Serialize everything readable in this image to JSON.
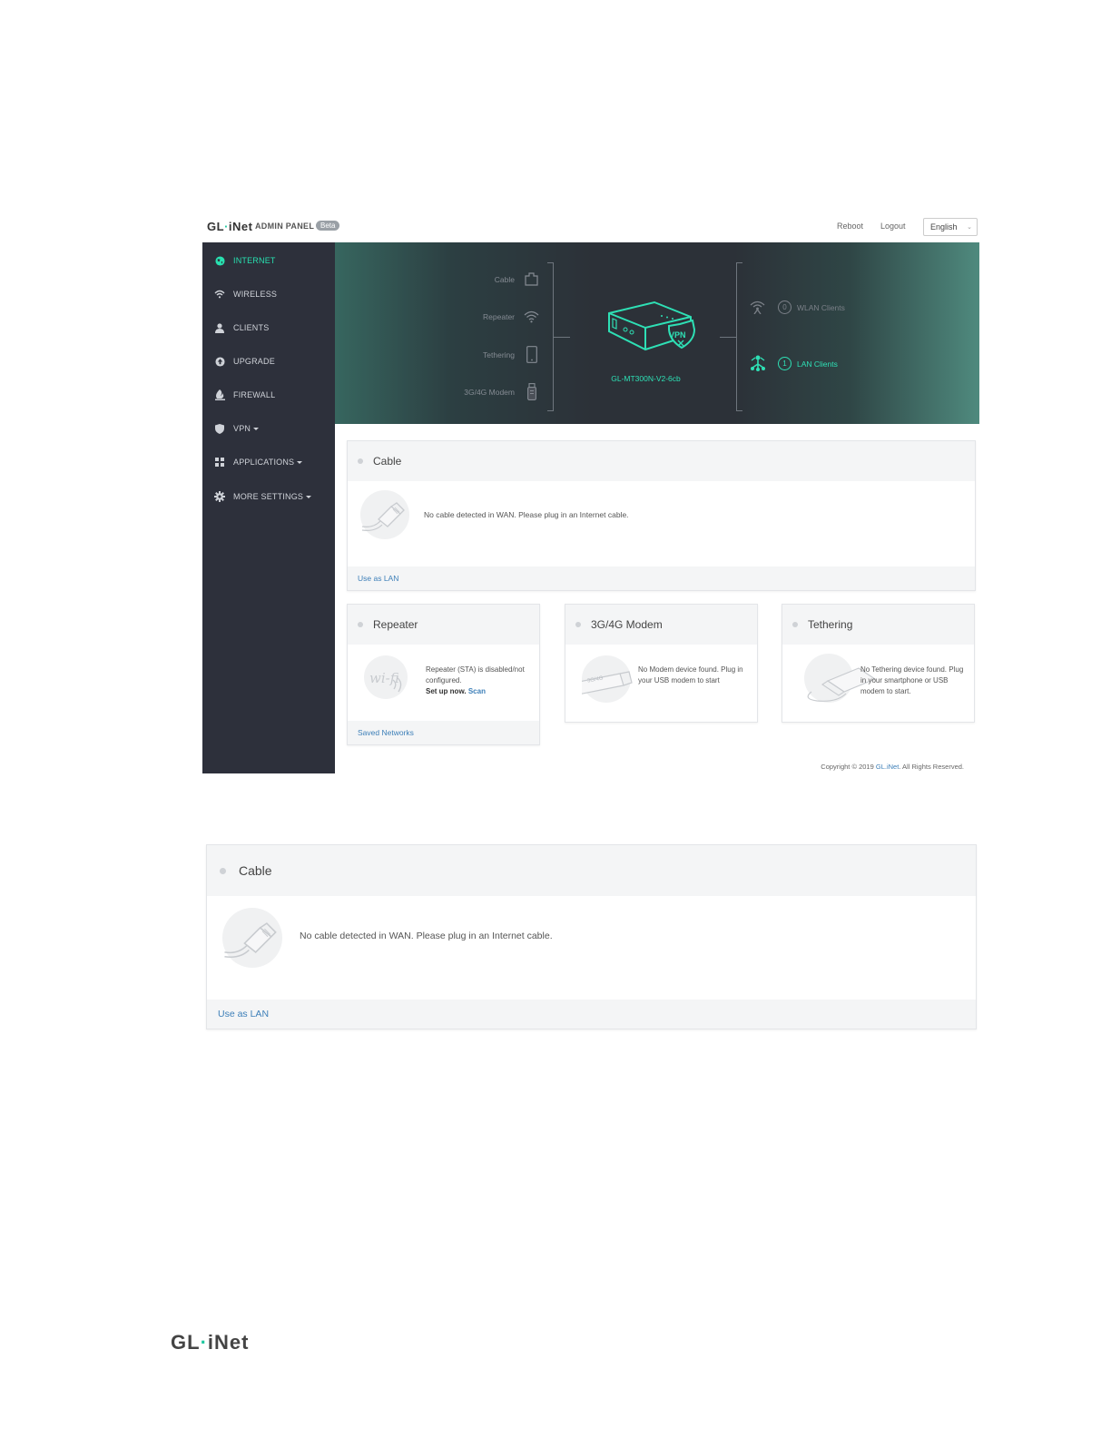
{
  "header": {
    "logo_left": "GL",
    "logo_dot": "·",
    "logo_right": "iNet",
    "admin_label": "ADMIN PANEL",
    "beta_badge": "Beta",
    "reboot": "Reboot",
    "logout": "Logout",
    "language": "English"
  },
  "sidebar": {
    "items": [
      {
        "label": "INTERNET",
        "icon": "globe-icon",
        "active": true
      },
      {
        "label": "WIRELESS",
        "icon": "wifi-icon"
      },
      {
        "label": "CLIENTS",
        "icon": "user-icon"
      },
      {
        "label": "UPGRADE",
        "icon": "upgrade-icon"
      },
      {
        "label": "FIREWALL",
        "icon": "firewall-icon"
      },
      {
        "label": "VPN",
        "icon": "shield-icon",
        "dropdown": true
      },
      {
        "label": "APPLICATIONS",
        "icon": "grid-icon",
        "dropdown": true
      },
      {
        "label": "MORE SETTINGS",
        "icon": "gear-icon",
        "dropdown": true
      }
    ]
  },
  "banner": {
    "sources": [
      {
        "label": "Cable",
        "icon": "ethernet-port-icon"
      },
      {
        "label": "Repeater",
        "icon": "wifi-icon"
      },
      {
        "label": "Tethering",
        "icon": "phone-icon"
      },
      {
        "label": "3G/4G Modem",
        "icon": "usb-modem-icon"
      }
    ],
    "device_name": "GL-MT300N-V2-6cb",
    "vpn_badge": "VPN",
    "clients": [
      {
        "count": "0",
        "label": "WLAN Clients",
        "icon": "wlan-antenna-icon"
      },
      {
        "count": "1",
        "label": "LAN Clients",
        "icon": "lan-network-icon"
      }
    ],
    "colors": {
      "accent": "#2ee0b5",
      "dark": "#2c3138"
    }
  },
  "cable_card": {
    "title": "Cable",
    "message": "No cable detected in WAN. Please plug in an Internet cable.",
    "footer_link": "Use as LAN"
  },
  "repeater_card": {
    "title": "Repeater",
    "message": "Repeater (STA) is disabled/not configured.",
    "setup_text": "Set up now.",
    "scan_link": "Scan",
    "footer_link": "Saved Networks"
  },
  "modem_card": {
    "title": "3G/4G Modem",
    "message": "No Modem device found. Plug in your USB modem to start",
    "usb_label": "3G/4G"
  },
  "tethering_card": {
    "title": "Tethering",
    "message": "No Tethering device found. Plug in your smartphone or USB modem to start."
  },
  "copyright": {
    "prefix": "Copyright © 2019",
    "brand": "GL.iNet",
    "suffix": ". All Rights Reserved."
  },
  "cable_zoom": {
    "title": "Cable",
    "message": "No cable detected in WAN. Please plug in an Internet cable.",
    "footer_link": "Use as LAN"
  },
  "footer_logo": {
    "left": "GL",
    "dot": "·",
    "right": "iNet"
  }
}
